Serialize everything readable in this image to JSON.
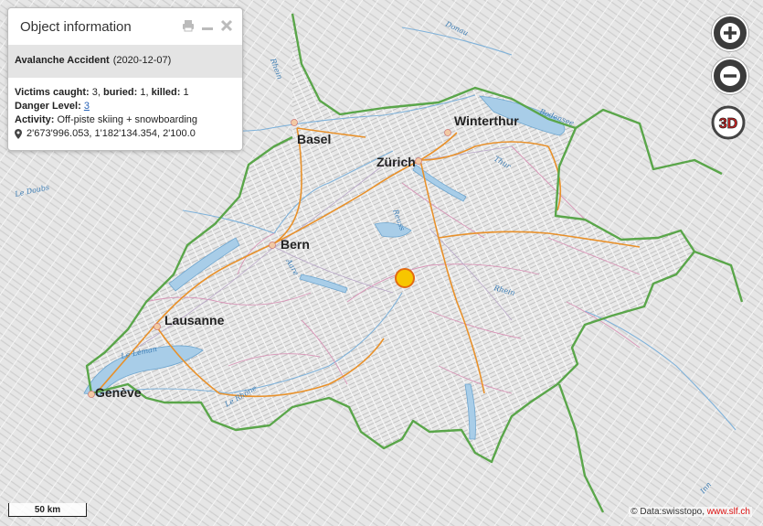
{
  "panel": {
    "title": "Object information",
    "accident_title": "Avalanche Accident",
    "accident_date": "(2020-12-07)",
    "victims_caught_label": "Victims caught:",
    "victims_caught": "3",
    "buried_label": "buried:",
    "buried": "1",
    "killed_label": "killed:",
    "killed": "1",
    "danger_label": "Danger Level:",
    "danger_value": "3",
    "activity_label": "Activity:",
    "activity_value": "Off-piste skiing + snowboarding",
    "coordinates": "2'673'996.053, 1'182'134.354, 2'100.0"
  },
  "map": {
    "cities": {
      "basel": "Basel",
      "zurich": "Zürich",
      "winterthur": "Winterthur",
      "bern": "Bern",
      "lausanne": "Lausanne",
      "geneve": "Genève"
    },
    "waters": {
      "bodensee": "Bodensee",
      "leman": "Le Léman",
      "doubs": "Le Doubs",
      "rhein": "Rhein",
      "aare": "Aare",
      "reuss": "Reuss",
      "thur": "Thur",
      "rhone": "Le Rhône",
      "donau": "Donau",
      "inn": "Inn"
    },
    "marker_color": "#f7c600",
    "border_color": "#5aa64a"
  },
  "controls": {
    "zoom_in": "+",
    "zoom_out": "−",
    "view_3d": "3D"
  },
  "scale": {
    "label": "50 km"
  },
  "attribution": {
    "data": "© Data:swisstopo,",
    "link": "www.slf.ch"
  }
}
